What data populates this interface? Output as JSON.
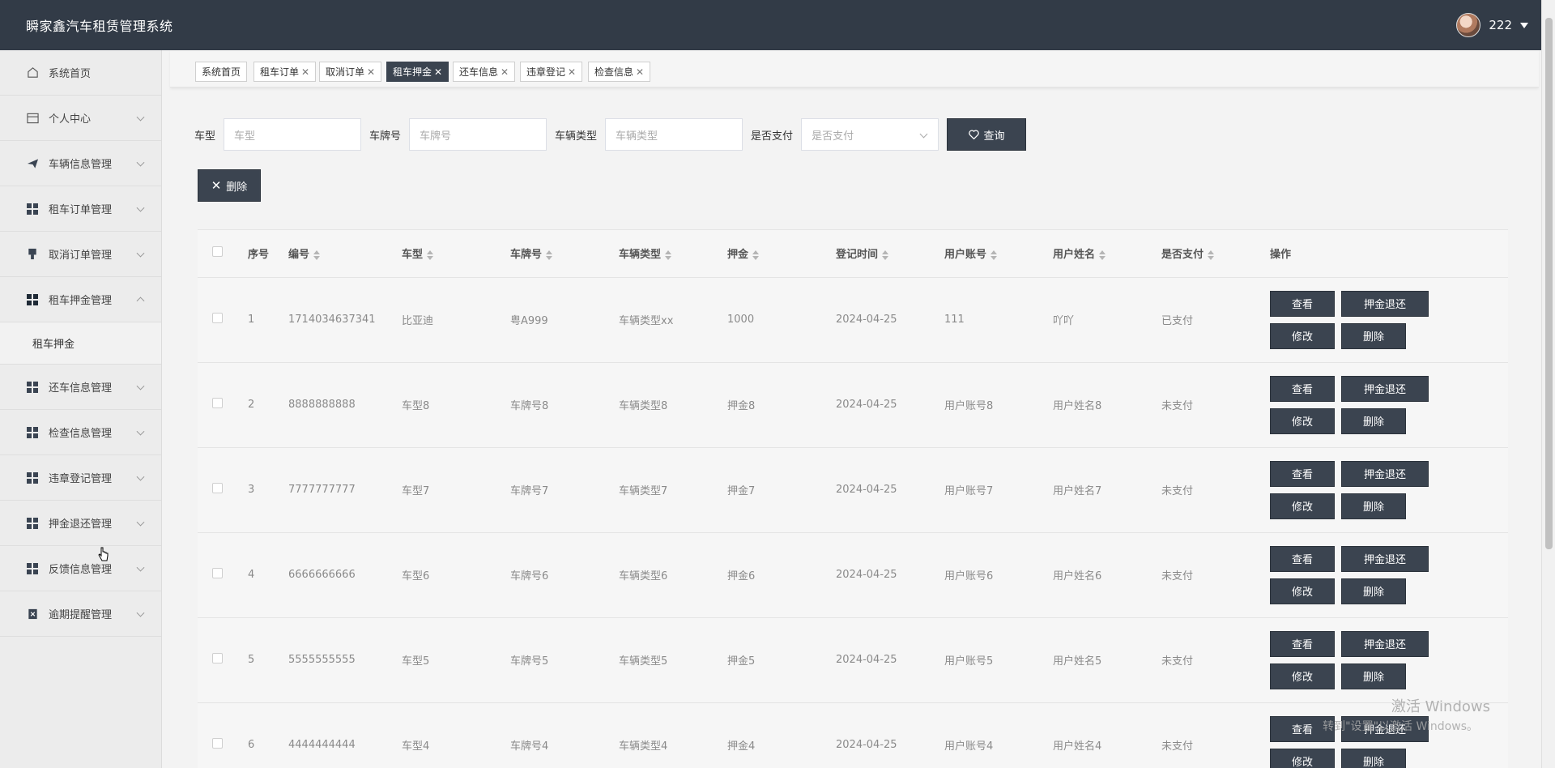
{
  "header": {
    "title": "瞬家鑫汽车租赁管理系统",
    "username": "222"
  },
  "sidebar": {
    "items": [
      {
        "label": "系统首页",
        "icon": "home-icon",
        "expandable": false
      },
      {
        "label": "个人中心",
        "icon": "card-icon",
        "expandable": true
      },
      {
        "label": "车辆信息管理",
        "icon": "send-icon",
        "expandable": true
      },
      {
        "label": "租车订单管理",
        "icon": "grid-icon",
        "expandable": true
      },
      {
        "label": "取消订单管理",
        "icon": "stamp-icon",
        "expandable": true
      },
      {
        "label": "租车押金管理",
        "icon": "grid-icon",
        "expandable": true,
        "expanded": true
      },
      {
        "label": "还车信息管理",
        "icon": "grid-icon",
        "expandable": true
      },
      {
        "label": "检查信息管理",
        "icon": "grid-icon",
        "expandable": true
      },
      {
        "label": "违章登记管理",
        "icon": "grid-icon",
        "expandable": true
      },
      {
        "label": "押金退还管理",
        "icon": "grid-icon",
        "expandable": true
      },
      {
        "label": "反馈信息管理",
        "icon": "grid-icon",
        "expandable": true
      },
      {
        "label": "逾期提醒管理",
        "icon": "clipboard-icon",
        "expandable": true
      }
    ],
    "submenu_label": "租车押金"
  },
  "tabs": [
    {
      "label": "系统首页",
      "closable": false
    },
    {
      "label": "租车订单",
      "closable": true
    },
    {
      "label": "取消订单",
      "closable": true
    },
    {
      "label": "租车押金",
      "closable": true,
      "active": true
    },
    {
      "label": "还车信息",
      "closable": true
    },
    {
      "label": "违章登记",
      "closable": true
    },
    {
      "label": "检查信息",
      "closable": true
    }
  ],
  "search": {
    "fields": [
      {
        "label": "车型",
        "placeholder": "车型"
      },
      {
        "label": "车牌号",
        "placeholder": "车牌号"
      },
      {
        "label": "车辆类型",
        "placeholder": "车辆类型"
      },
      {
        "label": "是否支付",
        "placeholder": "是否支付",
        "select": true
      }
    ],
    "query_label": "查询"
  },
  "toolbar": {
    "delete_label": "删除"
  },
  "table": {
    "columns": [
      "序号",
      "编号",
      "车型",
      "车牌号",
      "车辆类型",
      "押金",
      "登记时间",
      "用户账号",
      "用户姓名",
      "是否支付",
      "操作"
    ],
    "sortable": [
      false,
      true,
      true,
      true,
      true,
      true,
      true,
      true,
      true,
      true,
      false
    ],
    "rows": [
      [
        "1",
        "1714034637341",
        "比亚迪",
        "粤A999",
        "车辆类型xx",
        "1000",
        "2024-04-25",
        "111",
        "吖吖",
        "已支付"
      ],
      [
        "2",
        "8888888888",
        "车型8",
        "车牌号8",
        "车辆类型8",
        "押金8",
        "2024-04-25",
        "用户账号8",
        "用户姓名8",
        "未支付"
      ],
      [
        "3",
        "7777777777",
        "车型7",
        "车牌号7",
        "车辆类型7",
        "押金7",
        "2024-04-25",
        "用户账号7",
        "用户姓名7",
        "未支付"
      ],
      [
        "4",
        "6666666666",
        "车型6",
        "车牌号6",
        "车辆类型6",
        "押金6",
        "2024-04-25",
        "用户账号6",
        "用户姓名6",
        "未支付"
      ],
      [
        "5",
        "5555555555",
        "车型5",
        "车牌号5",
        "车辆类型5",
        "押金5",
        "2024-04-25",
        "用户账号5",
        "用户姓名5",
        "未支付"
      ],
      [
        "6",
        "4444444444",
        "车型4",
        "车牌号4",
        "车辆类型4",
        "押金4",
        "2024-04-25",
        "用户账号4",
        "用户姓名4",
        "未支付"
      ]
    ],
    "ops": {
      "view": "查看",
      "refund": "押金退还",
      "edit": "修改",
      "delete": "删除"
    }
  },
  "watermark": {
    "line1": "激活 Windows",
    "line2": "转到\"设置\"以激活 Windows。"
  },
  "colors": {
    "header_bg": "#323b47",
    "button_bg": "#3b4450"
  }
}
